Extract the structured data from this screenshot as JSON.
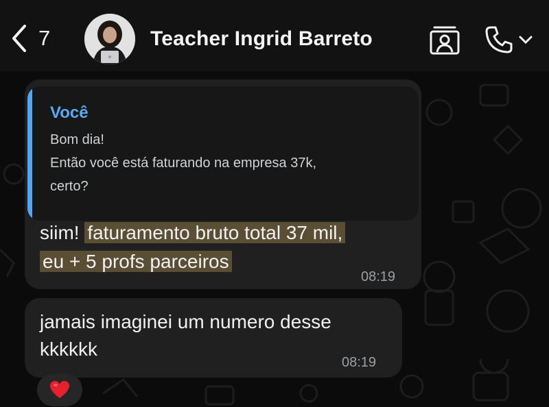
{
  "header": {
    "back_count": "7",
    "contact_name": "Teacher Ingrid Barreto",
    "icons": [
      "chevron-left-icon",
      "contact-card-icon",
      "phone-icon",
      "chevron-down-icon"
    ]
  },
  "messages": [
    {
      "quote": {
        "author": "Você",
        "lines": [
          "Bom dia!",
          "Então você está faturando na empresa 37k,",
          "certo?"
        ]
      },
      "text_plain": "siim!",
      "text_highlight_1": "faturamento bruto total 37 mil,",
      "text_highlight_2": "eu + 5 profs parceiros",
      "time": "08:19"
    },
    {
      "line1": "jamais imaginei um numero desse",
      "line2": "kkkkkk",
      "time": "08:19",
      "reaction": "❤️"
    }
  ],
  "colors": {
    "quote_accent": "#53a6f0",
    "highlight": "#5a4f35",
    "bubble": "#202020"
  }
}
